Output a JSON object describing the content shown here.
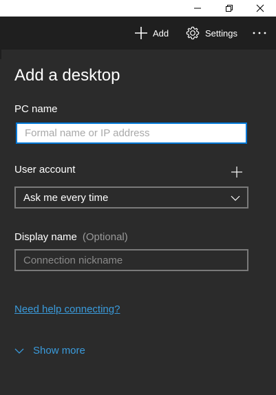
{
  "window": {
    "minimize_icon": "minimize-icon",
    "maximize_icon": "restore-icon",
    "close_icon": "close-icon"
  },
  "toolbar": {
    "add_label": "Add",
    "settings_label": "Settings",
    "more_icon": "more-icon"
  },
  "form": {
    "title": "Add a desktop",
    "pc_name": {
      "label": "PC name",
      "placeholder": "Formal name or IP address",
      "value": ""
    },
    "user_account": {
      "label": "User account",
      "selected": "Ask me every time"
    },
    "display_name": {
      "label": "Display name",
      "optional_label": "(Optional)",
      "placeholder": "Connection nickname"
    },
    "help_link": "Need help connecting?",
    "show_more": "Show more"
  },
  "colors": {
    "accent": "#0078d7",
    "link": "#3a9bdc",
    "panel_bg": "#2b2b2b",
    "toolbar_bg": "#1f1f1f"
  }
}
